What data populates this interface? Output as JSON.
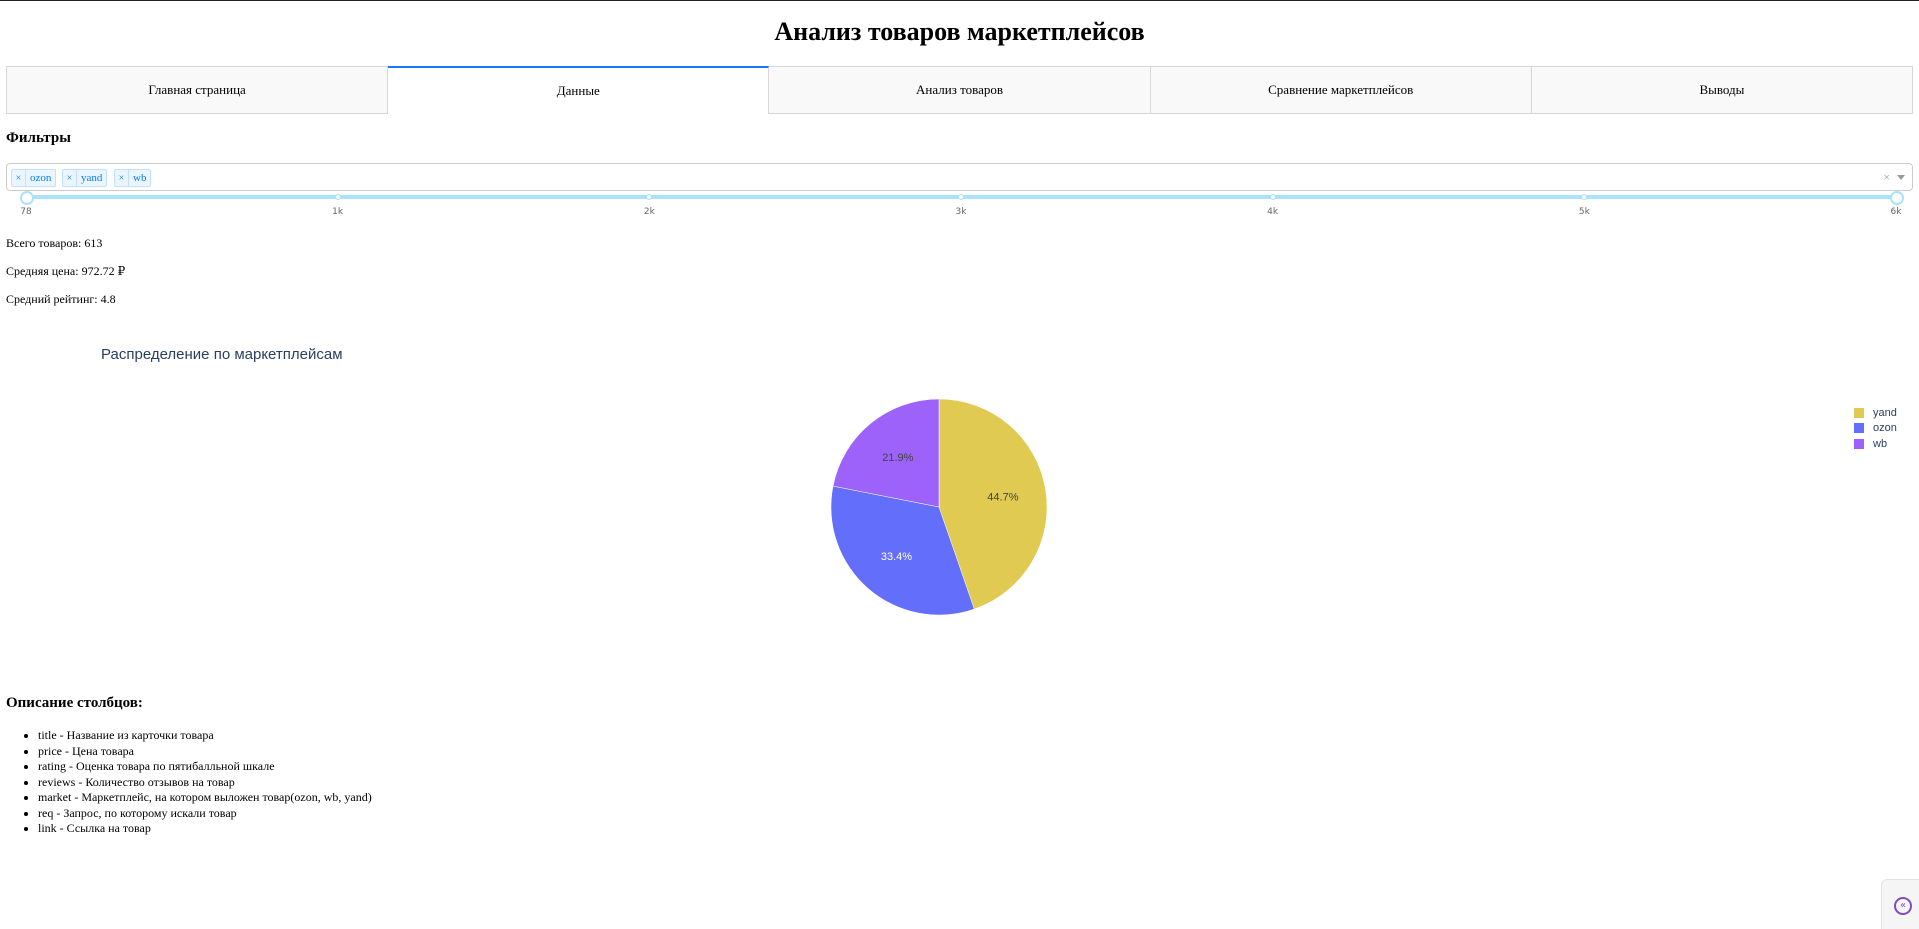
{
  "page_title": "Анализ товаров маркетплейсов",
  "tabs": [
    {
      "label": "Главная страница"
    },
    {
      "label": "Данные"
    },
    {
      "label": "Анализ товаров"
    },
    {
      "label": "Сравнение маркетплейсов"
    },
    {
      "label": "Выводы"
    }
  ],
  "active_tab": 1,
  "filters": {
    "heading": "Фильтры",
    "selected": [
      "ozon",
      "yand",
      "wb"
    ],
    "clear_label": "×",
    "price_slider": {
      "min": 78,
      "max": 6000,
      "value": [
        78,
        6000
      ],
      "marks": [
        "78",
        "1k",
        "2k",
        "3k",
        "4k",
        "5k",
        "6k"
      ]
    }
  },
  "stats": {
    "total": "Всего товаров: 613",
    "avg_price": "Средняя цена: 972.72 ₽",
    "avg_rating": "Средний рейтинг: 4.8"
  },
  "chart_data": {
    "type": "pie",
    "title": "Распределение по маркетплейсам",
    "labels": [
      "yand",
      "ozon",
      "wb"
    ],
    "values": [
      44.7,
      33.4,
      21.9
    ],
    "text": [
      "44.7%",
      "33.4%",
      "21.9%"
    ],
    "colors": [
      "#e0ca52",
      "#636efa",
      "#9d62fa"
    ],
    "label_colors": [
      "#444444",
      "#ffffff",
      "#444444"
    ],
    "legend_position": "right",
    "legend": [
      "yand",
      "ozon",
      "wb"
    ]
  },
  "description": {
    "heading": "Описание столбцов:",
    "items": [
      "title - Название из карточки товара",
      "price - Цена товара",
      "rating - Оценка товара по пятибалльной шкале",
      "reviews - Количество отзывов на товар",
      "market - Маркетплейс, на котором выложен товар(ozon, wb, yand)",
      "req - Запрос, по которому искали товар",
      "link - Ссылка на товар"
    ]
  },
  "devtools": {
    "icon": "chevrons-left-icon"
  }
}
